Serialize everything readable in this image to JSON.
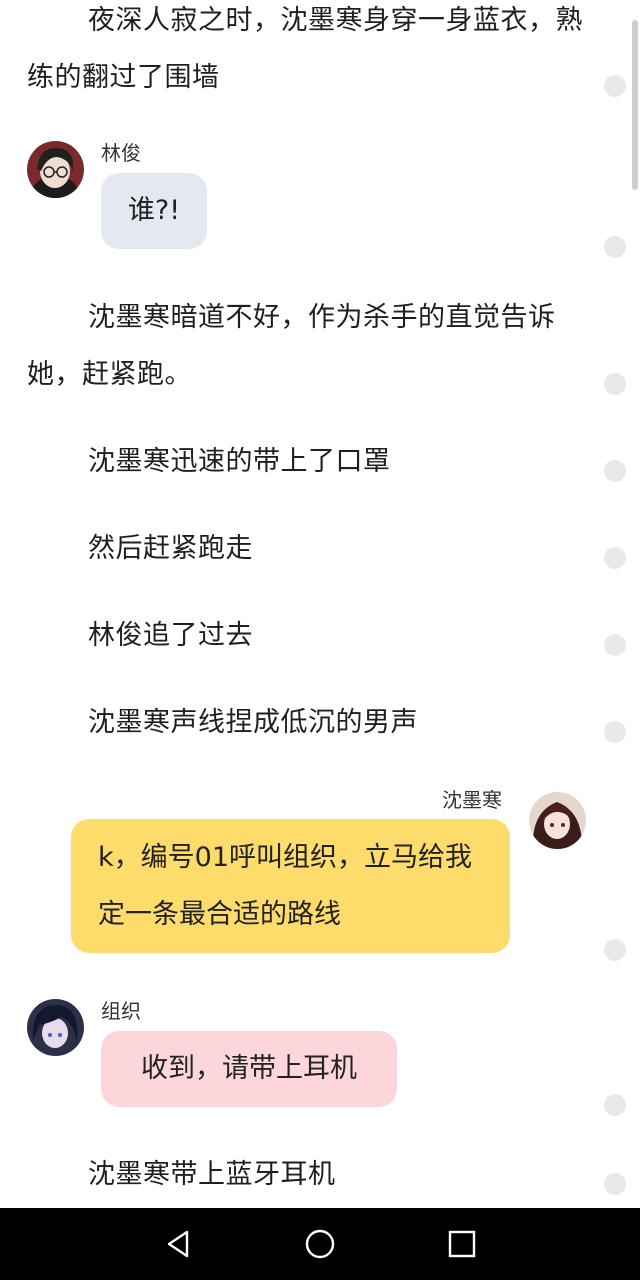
{
  "story": {
    "p1": "夜深人寂之时，沈墨寒身穿一身蓝衣，熟练的翻过了围墙",
    "p2": "沈墨寒暗道不好，作为杀手的直觉告诉她，赶紧跑。",
    "p3": "沈墨寒迅速的带上了口罩",
    "p4": "然后赶紧跑走",
    "p5": "林俊追了过去",
    "p6": "沈墨寒声线捏成低沉的男声",
    "p7": "沈墨寒带上蓝牙耳机"
  },
  "messages": [
    {
      "speaker": "林俊",
      "text": "谁?!",
      "side": "left",
      "color": "#e3e8f1"
    },
    {
      "speaker": "沈墨寒",
      "text": "k，编号01呼叫组织，立马给我定一条最合适的路线",
      "side": "right",
      "color": "#fddc6c"
    },
    {
      "speaker": "组织",
      "text": "收到，请带上耳机",
      "side": "left",
      "color": "#fdd6dc"
    }
  ],
  "nav": {
    "back": "back-icon",
    "home": "home-icon",
    "recents": "recents-icon"
  }
}
